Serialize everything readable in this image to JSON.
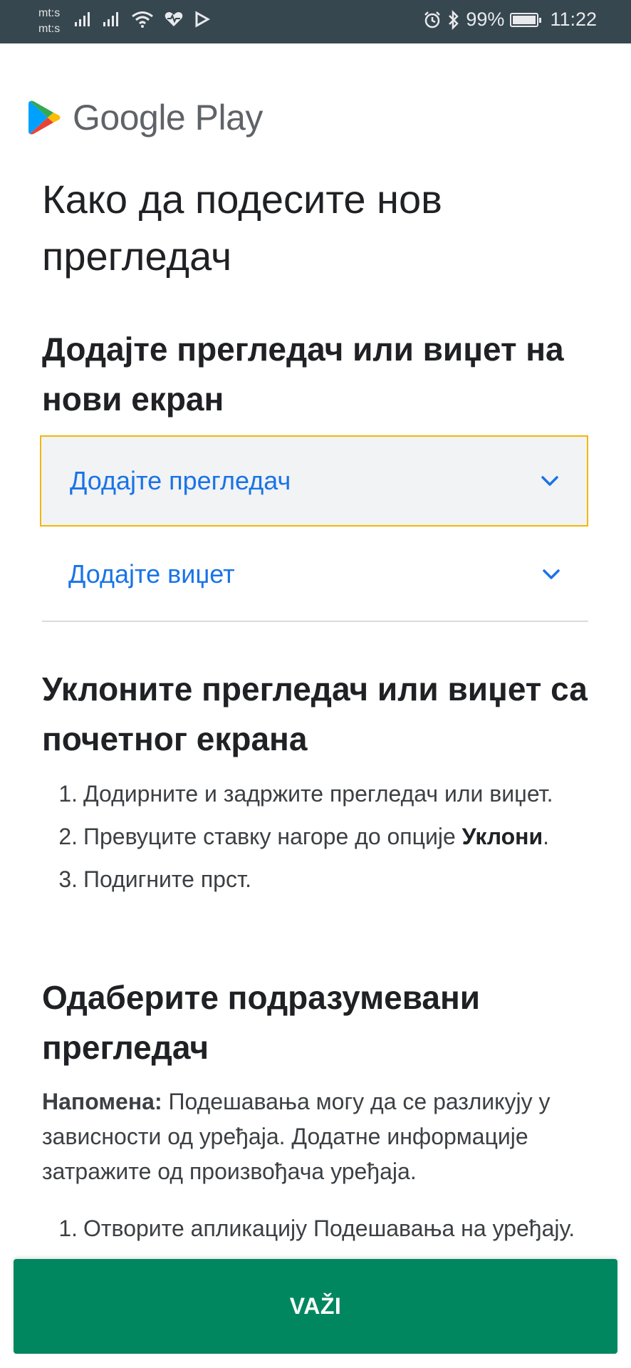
{
  "status_bar": {
    "carrier_1": "mt:s",
    "carrier_2": "mt:s",
    "battery_percent": "99%",
    "time": "11:22",
    "icons": [
      "signal-icon",
      "signal-icon",
      "wifi-icon",
      "health-icon",
      "play-store-notif-icon",
      "alarm-icon",
      "bluetooth-icon",
      "battery-icon"
    ]
  },
  "logo": {
    "text": "Google Play"
  },
  "page_title": "Како да подесите нов прегледач",
  "sections": {
    "add": {
      "heading": "Додајте прегледач или виџет на нови екран",
      "accordion": [
        {
          "label": "Додајте прегледач",
          "focused": true
        },
        {
          "label": "Додајте виџет",
          "focused": false
        }
      ]
    },
    "remove": {
      "heading": "Уклоните прегледач или виџет са почетног екрана",
      "steps": [
        {
          "num": "1.",
          "text": "Додирните и задржите прегледач или виџет."
        },
        {
          "num": "2.",
          "text_before": "Превуците ставку нагоре до опције ",
          "bold": "Уклони",
          "text_after": "."
        },
        {
          "num": "3.",
          "text": "Подигните прст."
        }
      ]
    },
    "default": {
      "heading": "Одаберите подразумевани прегледач",
      "note_label": "Напомена:",
      "note_text": " Подешавања могу да се разликују у зависности од уређаја. Додатне информације затражите од произвођача уређаја.",
      "steps": [
        {
          "num": "1.",
          "text": "Отворите апликацију Подешавања на уређају."
        }
      ]
    }
  },
  "action": {
    "ok_label": "VAŽI",
    "color": "#01875f"
  },
  "colors": {
    "status_bar": "#37474f",
    "link": "#1a73e8",
    "focus_border": "#f2b705"
  }
}
